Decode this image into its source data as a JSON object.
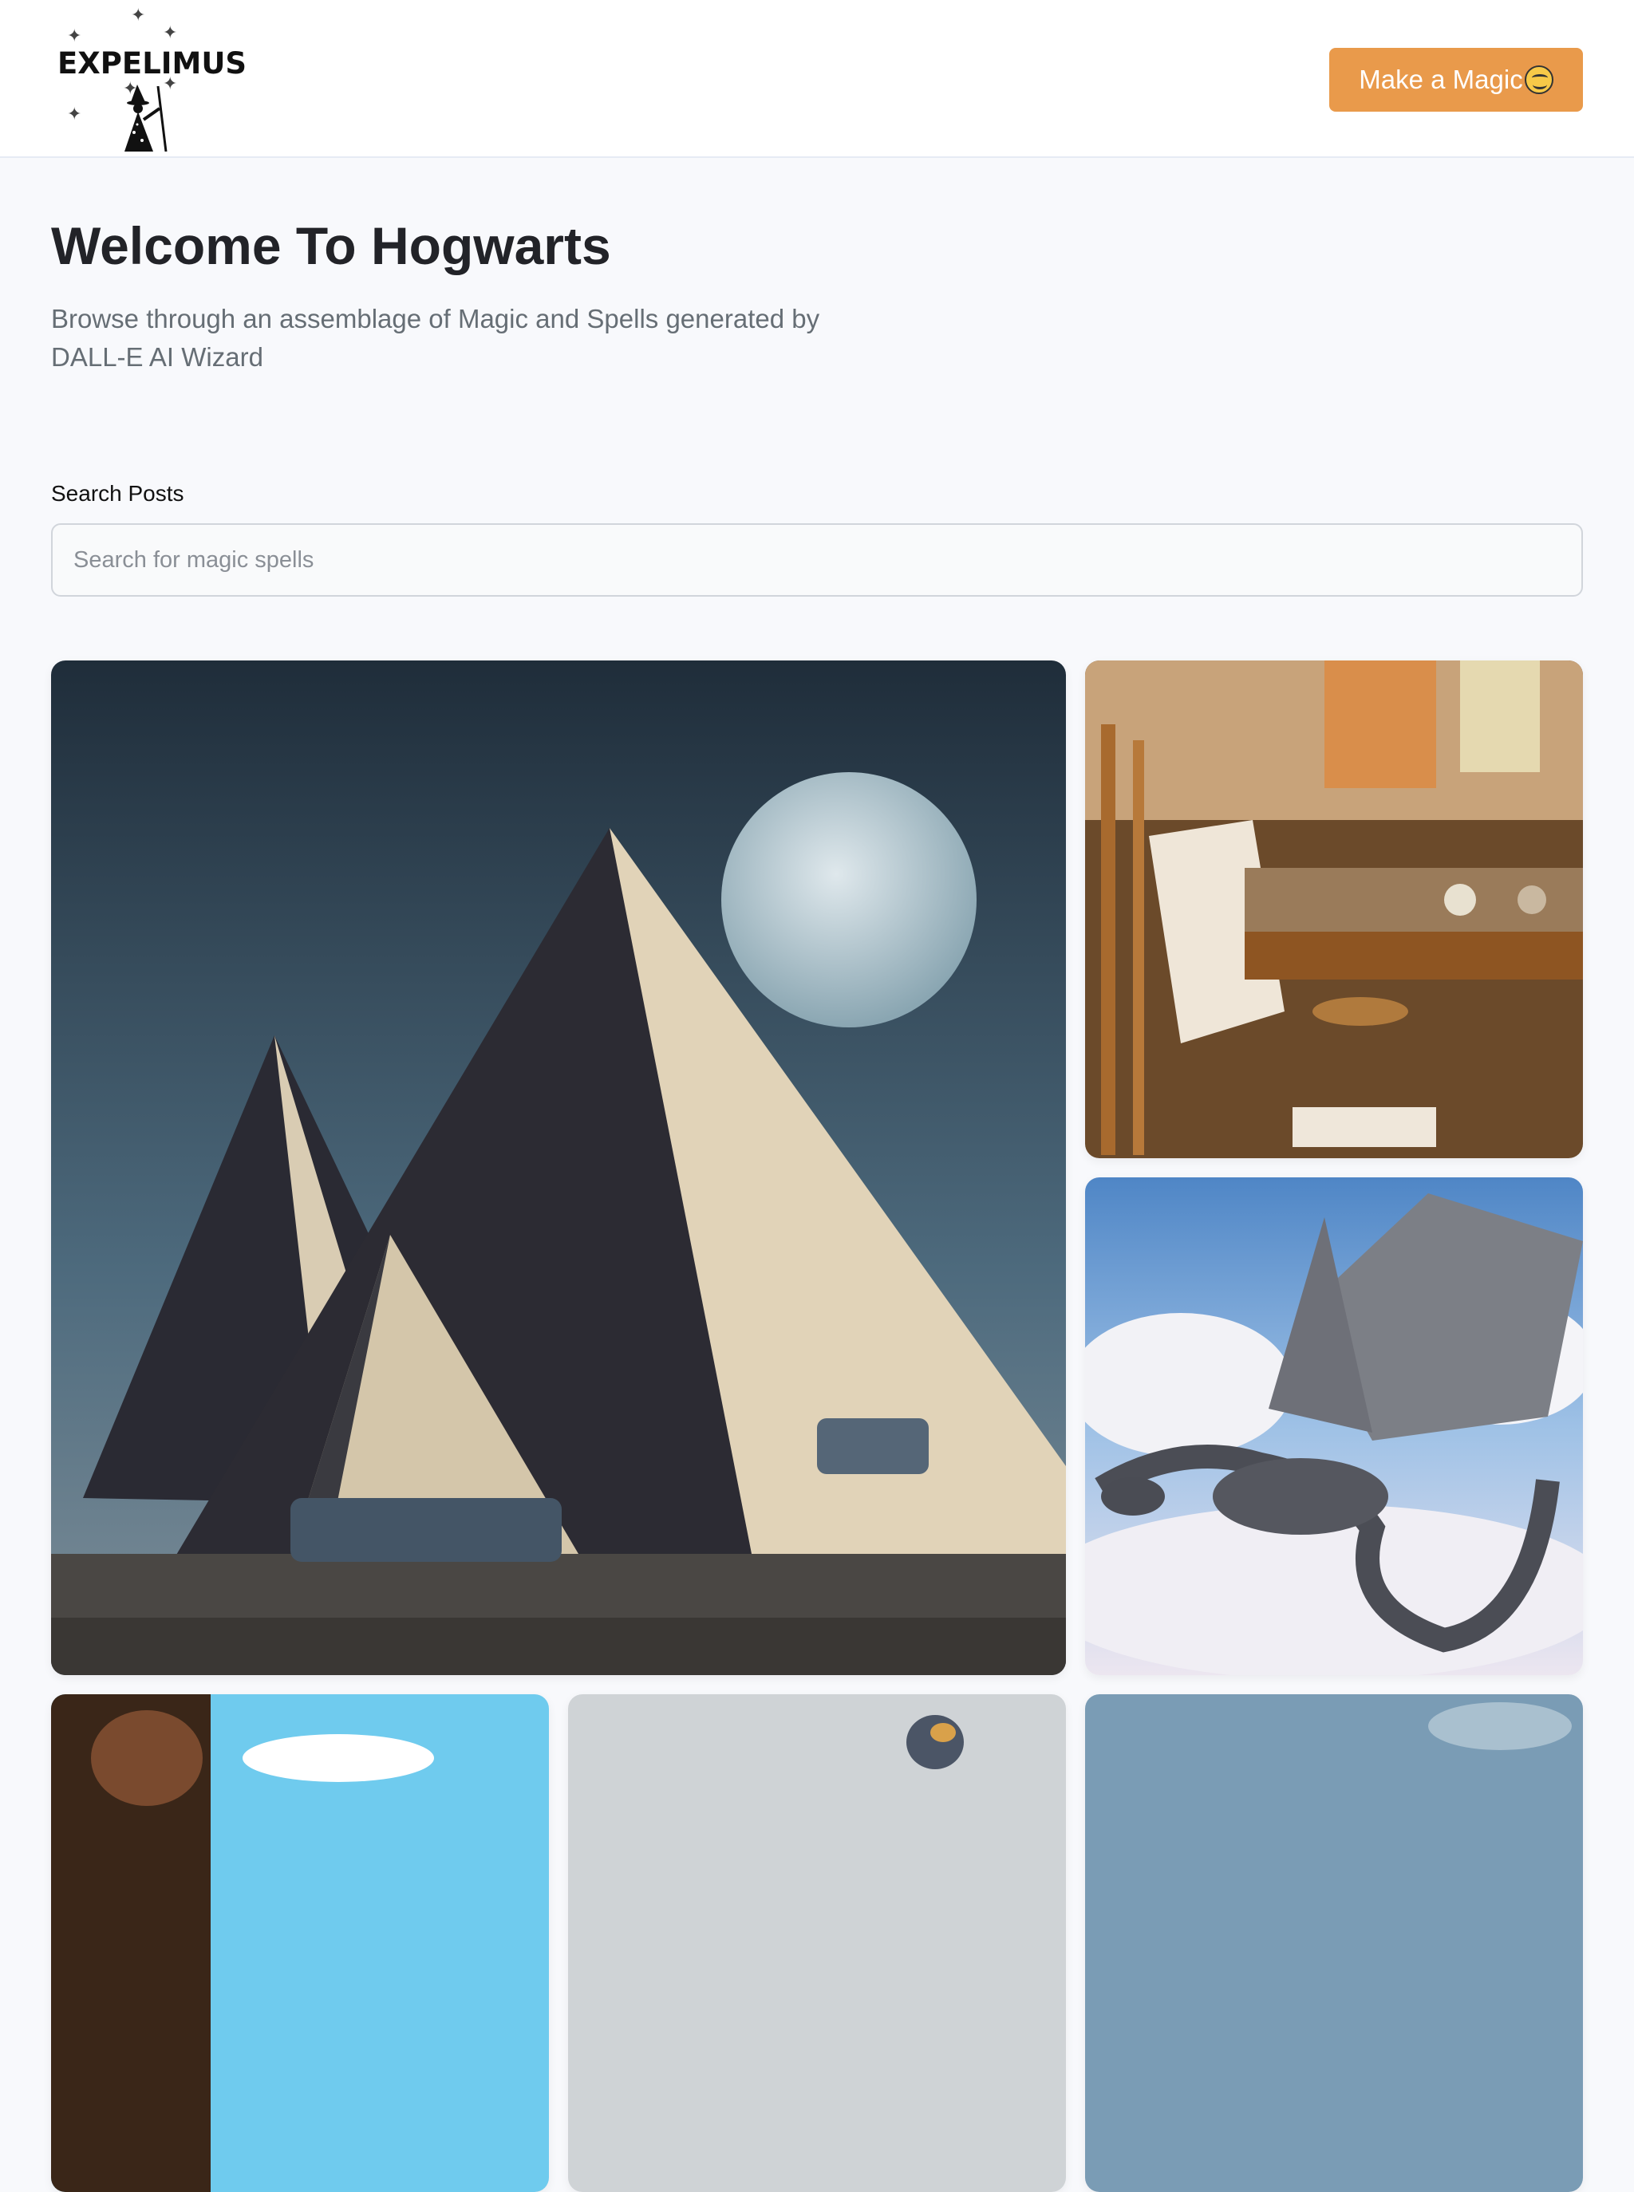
{
  "header": {
    "logo_text": "EXPELIMUS",
    "logo_icon": "wizard-icon",
    "cta_label": "Make a Magic",
    "cta_icon": "smiling-face-emoji-icon",
    "cta_color": "#e99a4b"
  },
  "hero": {
    "title": "Welcome To Hogwarts",
    "subtitle": "Browse through an assemblage of Magic and Spells generated by DALL-E AI Wizard"
  },
  "search": {
    "label": "Search Posts",
    "placeholder": "Search for magic spells",
    "value": ""
  },
  "gallery": {
    "items": [
      {
        "subject": "pyramids-with-moon-image"
      },
      {
        "subject": "artist-studio-image"
      },
      {
        "subject": "dragon-in-clouds-image"
      },
      {
        "subject": "portrait-sky-image"
      },
      {
        "subject": "figure-sky-image"
      },
      {
        "subject": "sky-image"
      }
    ]
  }
}
